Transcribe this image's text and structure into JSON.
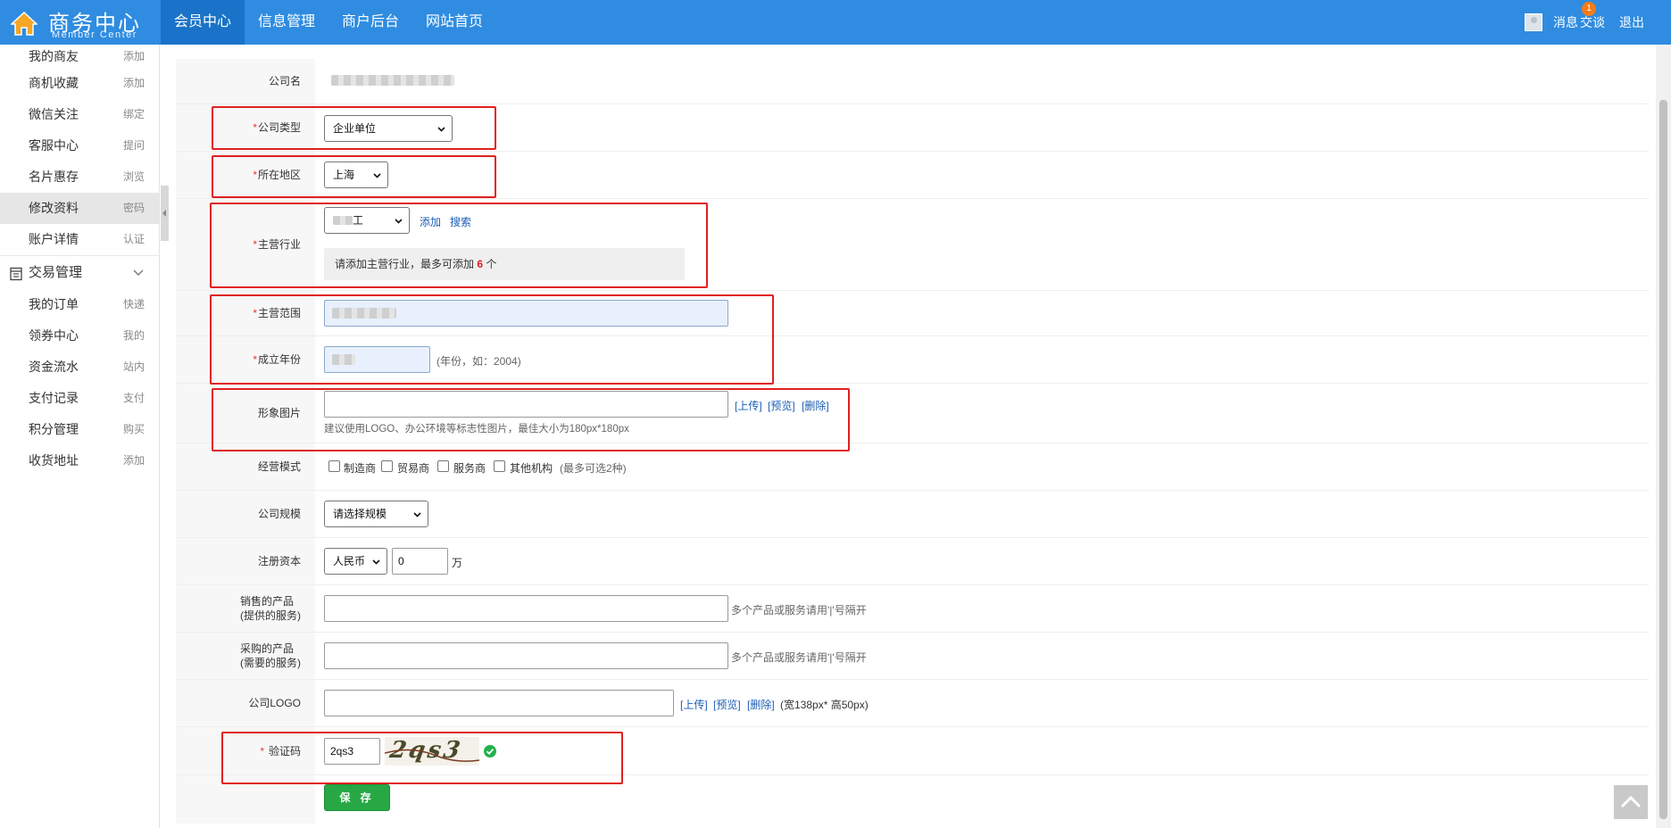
{
  "header": {
    "brand_title": "商务中心",
    "brand_subtitle": "Member Center",
    "nav": [
      "会员中心",
      "信息管理",
      "商户后台",
      "网站首页"
    ],
    "messages_label": "消息",
    "messages_badge": "1",
    "chat_label": "交谈",
    "logout_label": "退出"
  },
  "sidebar": {
    "items_top": [
      {
        "label": "我的商友",
        "action": "添加"
      },
      {
        "label": "商机收藏",
        "action": "添加"
      },
      {
        "label": "微信关注",
        "action": "绑定"
      },
      {
        "label": "客服中心",
        "action": "提问"
      },
      {
        "label": "名片惠存",
        "action": "浏览"
      },
      {
        "label": "修改资料",
        "action": "密码"
      },
      {
        "label": "账户详情",
        "action": "认证"
      }
    ],
    "group_label": "交易管理",
    "items_trade": [
      {
        "label": "我的订单",
        "action": "快递"
      },
      {
        "label": "领券中心",
        "action": "我的"
      },
      {
        "label": "资金流水",
        "action": "站内"
      },
      {
        "label": "支付记录",
        "action": "支付"
      },
      {
        "label": "积分管理",
        "action": "购买"
      },
      {
        "label": "收货地址",
        "action": "添加"
      }
    ]
  },
  "form": {
    "company_name_label": "公司名",
    "required_mark": "*",
    "company_type_label": "公司类型",
    "company_type_value": "企业单位",
    "region_label": "所在地区",
    "region_value": "上海",
    "industry_label": "主营行业",
    "industry_select_value": "工",
    "industry_add": "添加",
    "industry_search": "搜索",
    "industry_hint_prefix": "请添加主营行业，最多可添加",
    "industry_hint_count": "6",
    "industry_hint_suffix": "个",
    "scope_label": "主营范围",
    "year_label": "成立年份",
    "year_hint": "(年份，如：2004)",
    "image_label": "形象图片",
    "image_upload": "[上传]",
    "image_preview": "[预览]",
    "image_delete": "[删除]",
    "image_tip": "建议使用LOGO、办公环境等标志性图片，最佳大小为180px*180px",
    "mode_label": "经营模式",
    "mode_options": [
      "制造商",
      "贸易商",
      "服务商",
      "其他机构"
    ],
    "mode_hint": "(最多可选2种)",
    "scale_label": "公司规模",
    "scale_value": "请选择规模",
    "capital_label": "注册资本",
    "capital_currency": "人民币",
    "capital_value": "0",
    "capital_unit": "万",
    "sell_label_1": "销售的产品",
    "sell_label_2": "(提供的服务)",
    "buy_label_1": "采购的产品",
    "buy_label_2": "(需要的服务)",
    "products_tip": "多个产品或服务请用'|'号隔开",
    "logo_label": "公司LOGO",
    "logo_upload": "[上传]",
    "logo_preview": "[预览]",
    "logo_delete": "[删除]",
    "logo_tip": "(宽138px* 高50px)",
    "captcha_label": "验证码",
    "captcha_value": "2qs3",
    "captcha_image_text": "2qs3",
    "save_label": "保 存"
  },
  "colors": {
    "header_bg": "#2f8ce0",
    "nav_active": "#1a73c8",
    "required": "#e23b2e",
    "highlight_box": "#e02020",
    "save_button": "#27a845",
    "success": "#22b14c"
  },
  "icons": [
    "house-icon",
    "user-avatar-icon",
    "ledger-icon",
    "chevron-down-icon",
    "check-circle-icon",
    "arrow-up-icon"
  ]
}
